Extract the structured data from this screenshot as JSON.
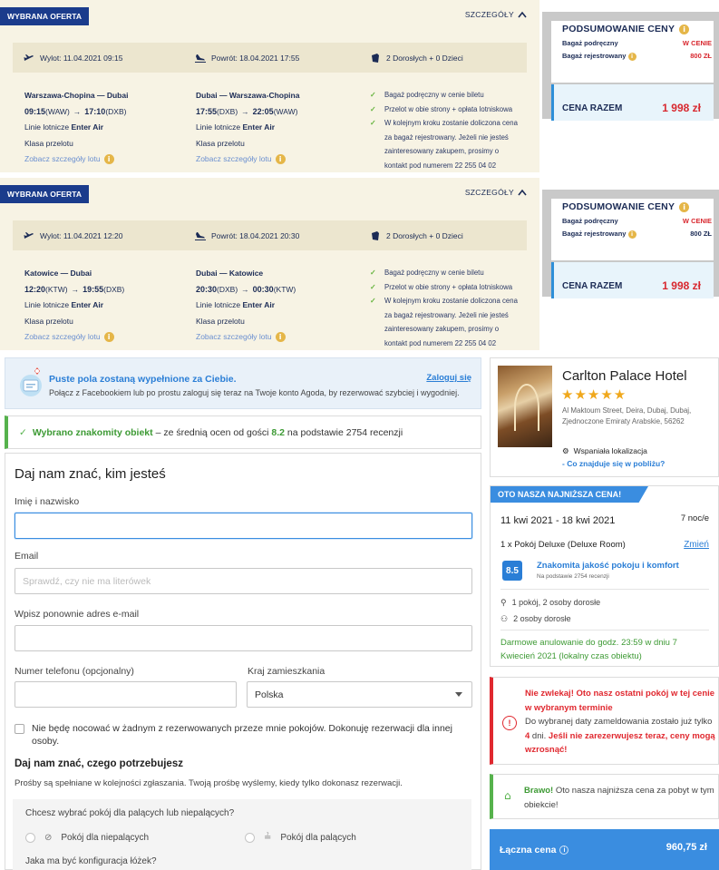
{
  "offers": [
    {
      "badge": "WYBRANA OFERTA",
      "details_label": "SZCZEGÓŁY",
      "departure": "Wylot: 11.04.2021 09:15",
      "return": "Powrót: 18.04.2021 17:55",
      "passengers": "2 Dorosłych + 0 Dzieci",
      "out": {
        "route": "Warszawa-Chopina — Dubai",
        "dep_time": "09:15",
        "dep_code": "(WAW)",
        "arr_time": "17:10",
        "arr_code": "(DXB)",
        "airline_prefix": "Linie lotnicze",
        "airline": "Enter Air",
        "class": "Klasa przelotu",
        "link": "Zobacz szczegóły lotu"
      },
      "back": {
        "route": "Dubai — Warszawa-Chopina",
        "dep_time": "17:55",
        "dep_code": "(DXB)",
        "arr_time": "22:05",
        "arr_code": "(WAW)",
        "airline_prefix": "Linie lotnicze",
        "airline": "Enter Air",
        "class": "Klasa przelotu",
        "link": "Zobacz szczegóły lotu"
      },
      "bullets": [
        "Bagaż podręczny w cenie biletu",
        "Przelot w obie strony + opłata lotniskowa",
        "W kolejnym kroku zostanie doliczona cena"
      ],
      "bullet_cont": [
        "za bagaż rejestrowany. Jeżeli nie jesteś",
        "zainteresowany zakupem, prosimy o",
        "kontakt pod numerem 22 255 04 02"
      ]
    },
    {
      "badge": "WYBRANA OFERTA",
      "details_label": "SZCZEGÓŁY",
      "departure": "Wylot: 11.04.2021 12:20",
      "return": "Powrót: 18.04.2021 20:30",
      "passengers": "2 Dorosłych + 0 Dzieci",
      "out": {
        "route": "Katowice — Dubai",
        "dep_time": "12:20",
        "dep_code": "(KTW)",
        "arr_time": "19:55",
        "arr_code": "(DXB)",
        "airline_prefix": "Linie lotnicze",
        "airline": "Enter Air",
        "class": "Klasa przelotu",
        "link": "Zobacz szczegóły lotu"
      },
      "back": {
        "route": "Dubai — Katowice",
        "dep_time": "20:30",
        "dep_code": "(DXB)",
        "arr_time": "00:30",
        "arr_code": "(KTW)",
        "airline_prefix": "Linie lotnicze",
        "airline": "Enter Air",
        "class": "Klasa przelotu",
        "link": "Zobacz szczegóły lotu"
      },
      "bullets": [
        "Bagaż podręczny w cenie biletu",
        "Przelot w obie strony + opłata lotniskowa",
        "W kolejnym kroku zostanie doliczona cena"
      ],
      "bullet_cont": [
        "za bagaż rejestrowany. Jeżeli nie jesteś",
        "zainteresowany zakupem, prosimy o",
        "kontakt pod numerem 22 255 04 02"
      ]
    }
  ],
  "summaries": [
    {
      "title": "PODSUMOWANIE CENY",
      "hand_label": "Bagaż podręczny",
      "hand_value": "W CENIE",
      "checked_label": "Bagaż rejestrowany",
      "checked_value": "800 ZŁ",
      "total_label": "CENA RAZEM",
      "total_value": "1 998 zł"
    },
    {
      "title": "PODSUMOWANIE CENY",
      "hand_label": "Bagaż podręczny",
      "hand_value": "W CENIE",
      "checked_label": "Bagaż rejestrowany",
      "checked_value": "800 ZŁ",
      "total_label": "CENA RAZEM",
      "total_value": "1 998 zł"
    }
  ],
  "facebook": {
    "title": "Puste pola zostaną wypełnione za Ciebie.",
    "subtitle": "Połącz z Facebookiem lub po prostu zaloguj się teraz na Twoje konto Agoda, by rezerwować szybciej i wygodniej.",
    "login": "Zaloguj się"
  },
  "rating_notice": {
    "highlight": "Wybrano znakomity obiekt",
    "text_before": " – ze średnią ocen od gości ",
    "score": "8.2",
    "text_after": " na podstawie 2754 recenzji"
  },
  "form": {
    "title": "Daj nam znać, kim jesteś",
    "name_label": "Imię i nazwisko",
    "email_label": "Email",
    "email_placeholder": "Sprawdź, czy nie ma literówek",
    "email2_label": "Wpisz ponownie adres e-mail",
    "phone_label": "Numer telefonu (opcjonalny)",
    "country_label": "Kraj zamieszkania",
    "country_value": "Polska",
    "not_staying": "Nie będę nocować w żadnym z rezerwowanych przeze mnie pokojów. Dokonuję rezerwacji dla innej osoby.",
    "needs_title": "Daj nam znać, czego potrzebujesz",
    "needs_sub": "Prośby są spełniane w kolejności zgłaszania. Twoją prośbę wyślemy, kiedy tylko dokonasz rezerwacji.",
    "smoking_q": "Chcesz wybrać pokój dla palących lub niepalących?",
    "non_smoking": "Pokój dla niepalących",
    "smoking": "Pokój dla palących",
    "beds_q": "Jaka ma być konfiguracja łóżek?"
  },
  "hotel": {
    "name": "Carlton Palace Hotel",
    "stars": "★★★★★",
    "address": "Al Maktoum Street, Deira, Dubaj, Dubaj, Zjednoczone Emiraty Arabskie, 56262",
    "location": "Wspaniała lokalizacja",
    "nearby": "- Co znajduje się w pobliżu?"
  },
  "deal": {
    "banner": "OTO NASZA NAJNIŻSZA CENA!",
    "dates": "11 kwi 2021 - 18 kwi 2021",
    "nights": "7 noc/e",
    "room": "1 x Pokój Deluxe (Deluxe Room)",
    "change": "Zmień",
    "score": "8.5",
    "quality": "Znakomita jakość pokoju i komfort",
    "quality_sub": "Na podstawie 2754 recenzji",
    "rooms_guests": "1 pokój, 2 osoby dorosłe",
    "guests": "2 osoby dorosłe",
    "cancel": "Darmowe anulowanie do godz. 23:59 w dniu 7 Kwiecień 2021 (lokalny czas obiektu)"
  },
  "urgent": {
    "red_line": "Nie zwlekaj! Oto nasz ostatni pokój w tej cenie w wybranym terminie",
    "text_a": "Do wybranej daty zameldowania zostało już tylko ",
    "days": "4",
    "text_b": " dni. ",
    "red_tail": "Jeśli nie zarezerwujesz teraz, ceny mogą wzrosnąć!"
  },
  "bravo": {
    "highlight": "Brawo!",
    "text": " Oto nasza najniższa cena za pobyt w tym obiekcie!"
  },
  "total": {
    "label": "Łączna cena",
    "value": "960,75 zł"
  },
  "colors": {
    "navy": "#1b3c8c",
    "accent_blue": "#3a8de0",
    "red": "#d8282f",
    "green": "#56b24c",
    "cream": "#f7f3e4"
  }
}
